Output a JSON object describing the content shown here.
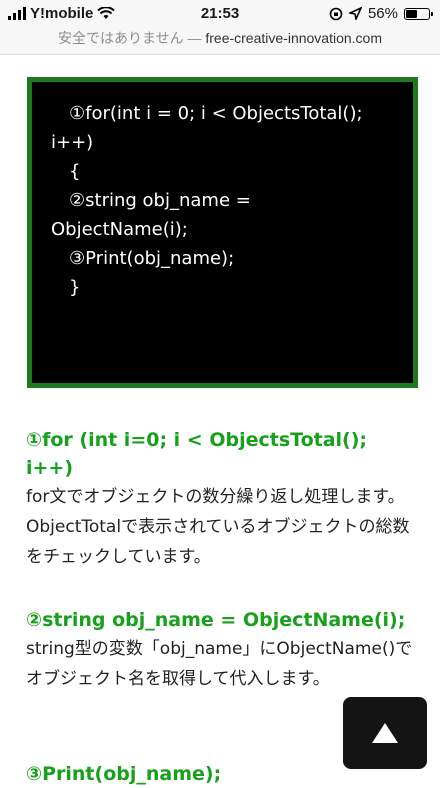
{
  "status_bar": {
    "carrier": "Y!mobile",
    "time": "21:53",
    "battery": "56%",
    "battery_level": 0.56,
    "icons": [
      "signal-icon",
      "wifi-icon",
      "orientation-lock-icon",
      "location-icon",
      "battery-icon"
    ]
  },
  "url_bar": {
    "warning": "安全ではありません —",
    "domain": "free-creative-innovation.com"
  },
  "code": {
    "lines": [
      "①for(int i = 0; i < ObjectsTotal();",
      "i++)",
      "{",
      "",
      "②string obj_name =",
      "ObjectName(i);",
      "③Print(obj_name);",
      "",
      "}"
    ]
  },
  "sections": [
    {
      "title": "①for (int i=0; i < ObjectsTotal(); i++)",
      "text": "for文でオブジェクトの数分繰り返し処理します。ObjectTotalで表示されているオブジェクトの総数をチェックしています。"
    },
    {
      "title": "②string obj_name = ObjectName(i);",
      "text": "string型の変数「obj_name」にObjectName()でオブジェクト名を取得して代入します。"
    },
    {
      "title": "③Print(obj_name);"
    }
  ],
  "colors": {
    "accent_green": "#17a01b",
    "code_border": "#1f7a1f",
    "code_bg": "#000000"
  }
}
